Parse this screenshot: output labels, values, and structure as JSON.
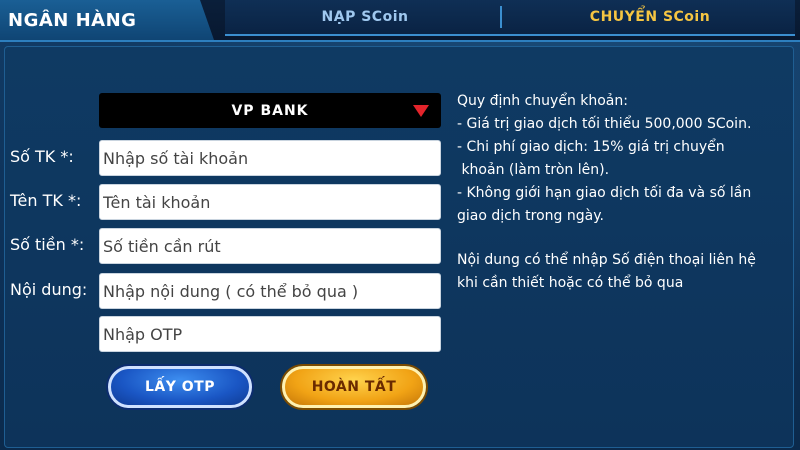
{
  "header": {
    "title": "NGÂN HÀNG",
    "tabs": [
      {
        "label": "NẠP SCoin",
        "active": false
      },
      {
        "label": "CHUYỂN SCoin",
        "active": true
      }
    ]
  },
  "form": {
    "bank_select": {
      "value": "VP BANK"
    },
    "fields": [
      {
        "label": "Số TK *:",
        "placeholder": "Nhập số tài khoản"
      },
      {
        "label": "Tên TK *:",
        "placeholder": "Tên tài khoản"
      },
      {
        "label": "Số tiền *:",
        "placeholder": "Số tiền cần rút"
      },
      {
        "label": "Nội dung:",
        "placeholder": "Nhập nội dung ( có thể bỏ qua )"
      },
      {
        "label": "",
        "placeholder": "Nhập OTP"
      }
    ],
    "buttons": {
      "get_otp": "LẤY OTP",
      "done": "HOÀN TẤT"
    }
  },
  "rules": {
    "lines": [
      "Quy định chuyển khoản:",
      "- Giá trị giao dịch tối thiểu 500,000 SCoin.",
      "- Chi phí giao dịch: 15% giá trị chuyển",
      " khoản (làm tròn lên).",
      "- Không giới hạn giao dịch tối đa và số lần",
      "giao dịch trong ngày."
    ],
    "note_lines": [
      "Nội dung có thể nhập Số điện thoại liên hệ",
      "khi cần thiết hoặc có thể bỏ qua"
    ]
  },
  "colors": {
    "accent_gold": "#f5c542",
    "accent_blue": "#3b8fd0",
    "dropdown_caret": "#e3242b"
  }
}
